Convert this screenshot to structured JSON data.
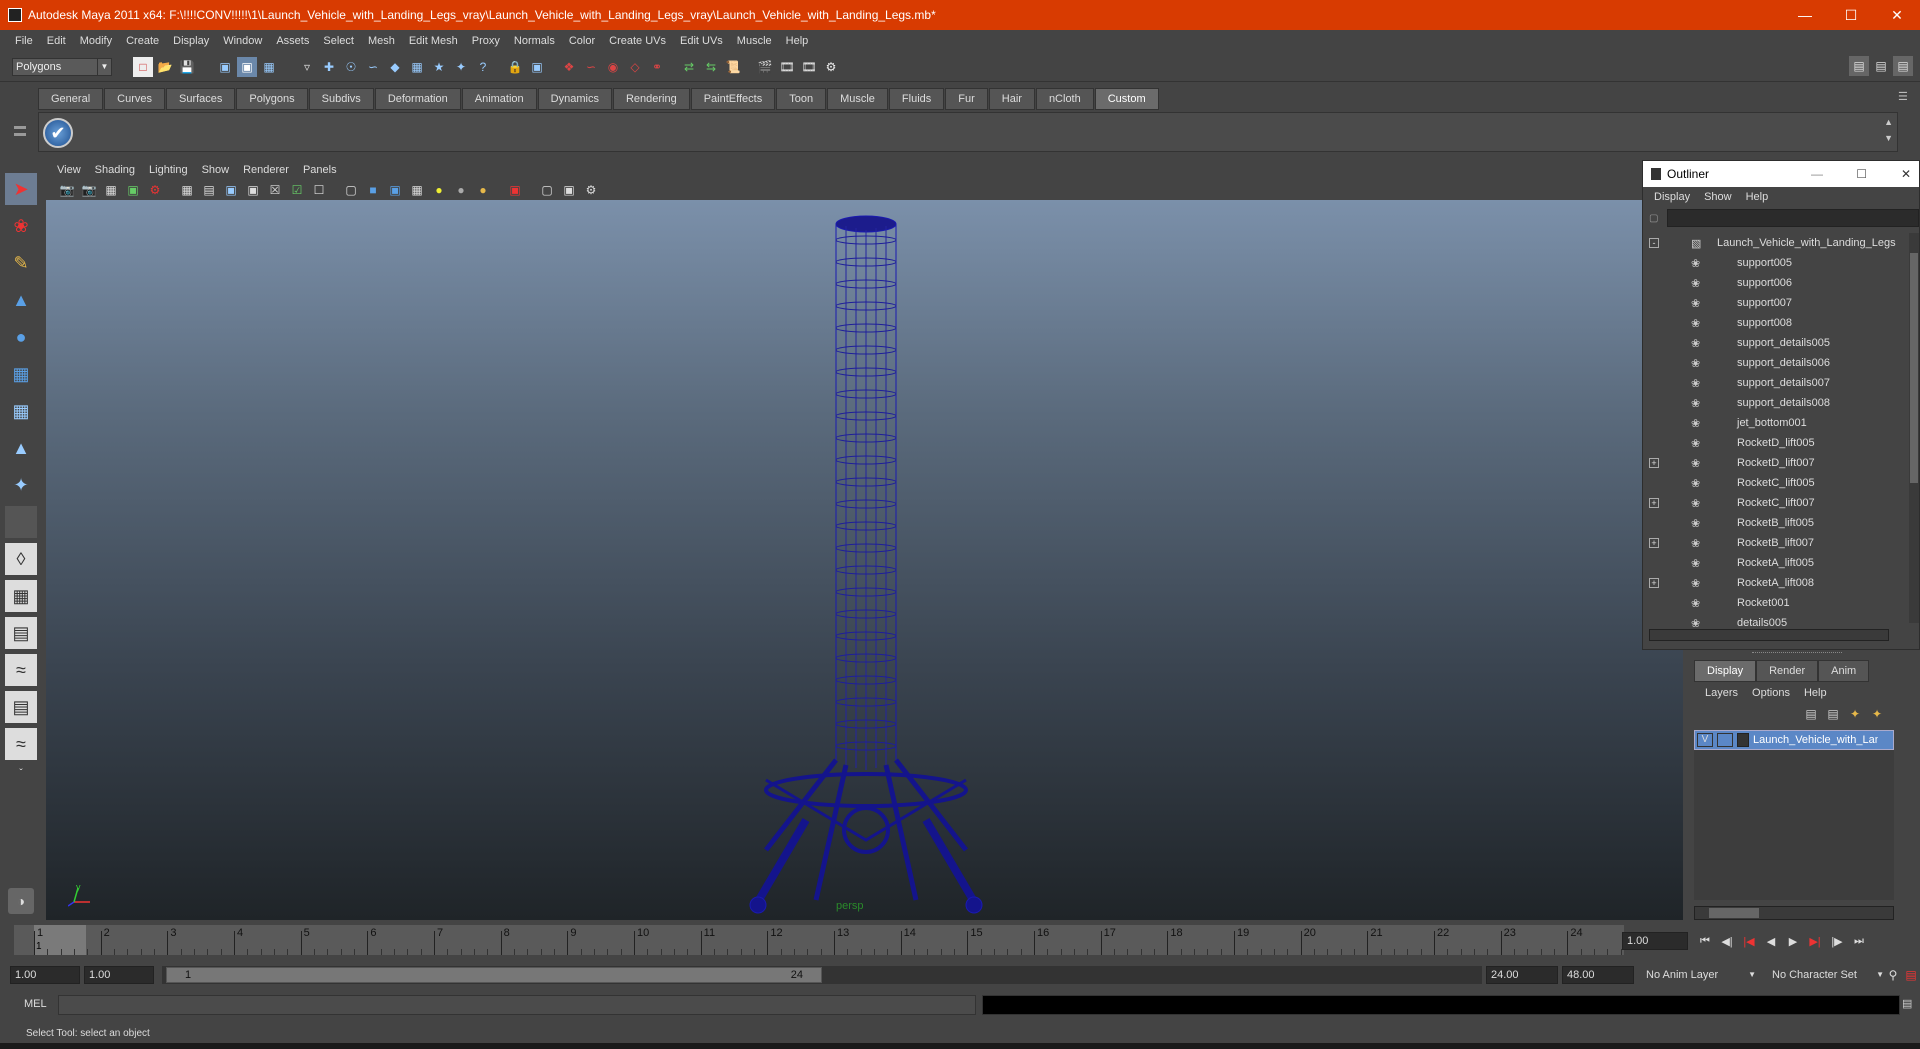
{
  "titlebar": {
    "title": "Autodesk Maya 2011 x64: F:\\!!!!CONV!!!!!\\1\\Launch_Vehicle_with_Landing_Legs_vray\\Launch_Vehicle_with_Landing_Legs_vray\\Launch_Vehicle_with_Landing_Legs.mb*"
  },
  "menu": [
    "File",
    "Edit",
    "Modify",
    "Create",
    "Display",
    "Window",
    "Assets",
    "Select",
    "Mesh",
    "Edit Mesh",
    "Proxy",
    "Normals",
    "Color",
    "Create UVs",
    "Edit UVs",
    "Muscle",
    "Help"
  ],
  "status": {
    "mode": "Polygons"
  },
  "shelf_tabs": [
    "General",
    "Curves",
    "Surfaces",
    "Polygons",
    "Subdivs",
    "Deformation",
    "Animation",
    "Dynamics",
    "Rendering",
    "PaintEffects",
    "Toon",
    "Muscle",
    "Fluids",
    "Fur",
    "Hair",
    "nCloth",
    "Custom"
  ],
  "shelf_active": "Custom",
  "viewport": {
    "menu": [
      "View",
      "Shading",
      "Lighting",
      "Show",
      "Renderer",
      "Panels"
    ],
    "camera": "persp"
  },
  "outliner": {
    "title": "Outliner",
    "menu": [
      "Display",
      "Show",
      "Help"
    ],
    "items": [
      {
        "name": "Launch_Vehicle_with_Landing_Legs",
        "expand": "-"
      },
      {
        "name": "support005",
        "expand": ""
      },
      {
        "name": "support006",
        "expand": ""
      },
      {
        "name": "support007",
        "expand": ""
      },
      {
        "name": "support008",
        "expand": ""
      },
      {
        "name": "support_details005",
        "expand": ""
      },
      {
        "name": "support_details006",
        "expand": ""
      },
      {
        "name": "support_details007",
        "expand": ""
      },
      {
        "name": "support_details008",
        "expand": ""
      },
      {
        "name": "jet_bottom001",
        "expand": ""
      },
      {
        "name": "RocketD_lift005",
        "expand": ""
      },
      {
        "name": "RocketD_lift007",
        "expand": "+"
      },
      {
        "name": "RocketC_lift005",
        "expand": ""
      },
      {
        "name": "RocketC_lift007",
        "expand": "+"
      },
      {
        "name": "RocketB_lift005",
        "expand": ""
      },
      {
        "name": "RocketB_lift007",
        "expand": "+"
      },
      {
        "name": "RocketA_lift005",
        "expand": ""
      },
      {
        "name": "RocketA_lift008",
        "expand": "+"
      },
      {
        "name": "Rocket001",
        "expand": ""
      },
      {
        "name": "details005",
        "expand": ""
      }
    ]
  },
  "layers": {
    "tabs": [
      "Display",
      "Render",
      "Anim"
    ],
    "active": "Display",
    "menu": [
      "Layers",
      "Options",
      "Help"
    ],
    "layer": {
      "v": "V",
      "name": "Launch_Vehicle_with_Landing_Legs"
    }
  },
  "timeline": {
    "ticks": [
      "1",
      "2",
      "3",
      "4",
      "5",
      "6",
      "7",
      "8",
      "9",
      "10",
      "11",
      "12",
      "13",
      "14",
      "15",
      "16",
      "17",
      "18",
      "19",
      "20",
      "21",
      "22",
      "23",
      "24"
    ],
    "current": "1",
    "current_field": "1.00"
  },
  "range": {
    "start": "1.00",
    "inner_start": "1.00",
    "slider_start": "1",
    "slider_end": "24",
    "end": "24.00",
    "outer_end": "48.00",
    "anim_layer": "No Anim Layer",
    "char_set": "No Character Set"
  },
  "mel": {
    "label": "MEL"
  },
  "help": {
    "text": "Select Tool: select an object"
  }
}
